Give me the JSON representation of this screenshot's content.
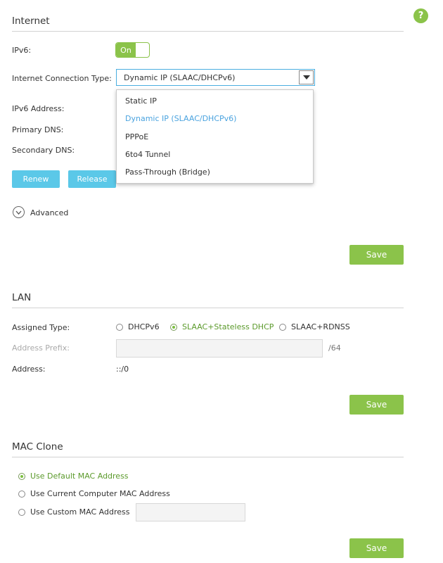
{
  "internet": {
    "title": "Internet",
    "ipv6_label": "IPv6:",
    "ipv6_toggle": "On",
    "connection_type_label": "Internet Connection Type:",
    "connection_type_value": "Dynamic IP (SLAAC/DHCPv6)",
    "connection_type_options": [
      "Static IP",
      "Dynamic IP (SLAAC/DHCPv6)",
      "PPPoE",
      "6to4 Tunnel",
      "Pass-Through (Bridge)"
    ],
    "ipv6_address_label": "IPv6 Address:",
    "primary_dns_label": "Primary DNS:",
    "secondary_dns_label": "Secondary DNS:",
    "renew_label": "Renew",
    "release_label": "Release",
    "advanced_label": "Advanced",
    "save_label": "Save"
  },
  "lan": {
    "title": "LAN",
    "assigned_type_label": "Assigned Type:",
    "assigned_options": [
      "DHCPv6",
      "SLAAC+Stateless DHCP",
      "SLAAC+RDNSS"
    ],
    "assigned_selected": "SLAAC+Stateless DHCP",
    "address_prefix_label": "Address Prefix:",
    "address_prefix_value": "",
    "prefix_suffix": "/64",
    "address_label": "Address:",
    "address_value": "::/0",
    "save_label": "Save"
  },
  "mac_clone": {
    "title": "MAC Clone",
    "options": [
      "Use Default MAC Address",
      "Use Current Computer MAC Address",
      "Use Custom MAC Address"
    ],
    "selected": "Use Default MAC Address",
    "custom_mac_value": "",
    "save_label": "Save"
  },
  "help": {
    "label": "?"
  },
  "colors": {
    "accent_green": "#8bc34a",
    "accent_blue": "#5bc8e8",
    "select_border": "#4aaee0"
  }
}
